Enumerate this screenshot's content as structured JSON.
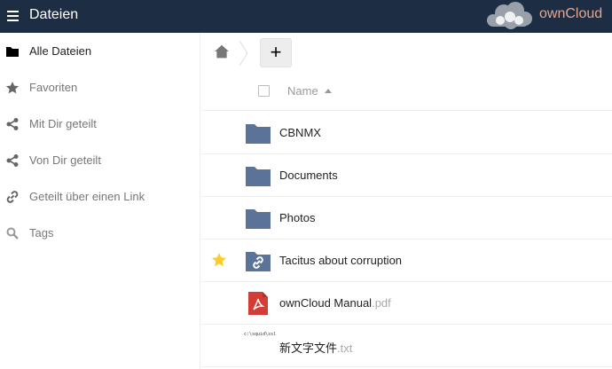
{
  "header": {
    "app_title": "Dateien",
    "logo_text": "ownCloud",
    "colors": {
      "background": "#1d2d44",
      "logo_accent": "#e8a58e"
    }
  },
  "sidebar": {
    "items": [
      {
        "label": "Alle Dateien",
        "icon": "folder-icon",
        "active": true
      },
      {
        "label": "Favoriten",
        "icon": "star-icon",
        "active": false
      },
      {
        "label": "Mit Dir geteilt",
        "icon": "share-icon",
        "active": false
      },
      {
        "label": "Von Dir geteilt",
        "icon": "share-icon",
        "active": false
      },
      {
        "label": "Geteilt über einen Link",
        "icon": "link-icon",
        "active": false
      },
      {
        "label": "Tags",
        "icon": "tag-search-icon",
        "active": false
      }
    ]
  },
  "controls": {
    "new_label": "+"
  },
  "table": {
    "name_header": "Name",
    "files": [
      {
        "name": "CBNMX",
        "ext": "",
        "type": "folder",
        "favorite": false
      },
      {
        "name": "Documents",
        "ext": "",
        "type": "folder",
        "favorite": false
      },
      {
        "name": "Photos",
        "ext": "",
        "type": "folder",
        "favorite": false
      },
      {
        "name": "Tacitus about corruption",
        "ext": "",
        "type": "shared-folder",
        "favorite": true
      },
      {
        "name": "ownCloud Manual",
        "ext": ".pdf",
        "type": "pdf",
        "favorite": false
      },
      {
        "name": "新文字文件",
        "ext": ".txt",
        "type": "txt",
        "favorite": false,
        "preview_text": "c:\\squid\\ssl"
      }
    ]
  },
  "colors": {
    "folder": "#5b7299",
    "favorite_star": "#fccd26",
    "pdf": "#d23d36"
  }
}
